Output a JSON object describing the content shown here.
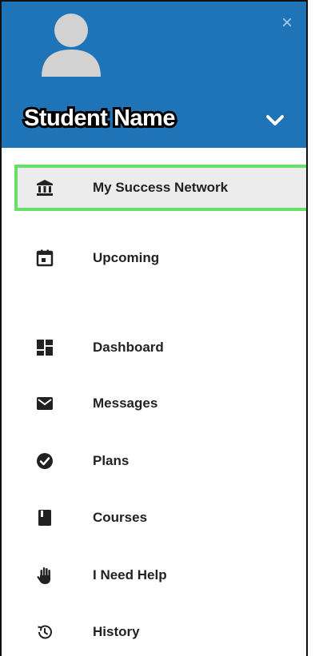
{
  "header": {
    "student_name": "Student Name",
    "close_icon": "×",
    "background_color": "#1f73b7"
  },
  "nav": {
    "items": [
      {
        "label": "My Success Network",
        "icon": "bank-icon",
        "active": true
      },
      {
        "label": "Upcoming",
        "icon": "calendar-icon"
      },
      {
        "label": "Dashboard",
        "icon": "dashboard-icon"
      },
      {
        "label": "Messages",
        "icon": "mail-icon"
      },
      {
        "label": "Plans",
        "icon": "check-circle-icon"
      },
      {
        "label": "Courses",
        "icon": "book-icon"
      },
      {
        "label": "I Need Help",
        "icon": "hand-icon"
      },
      {
        "label": "History",
        "icon": "history-icon"
      }
    ],
    "active_highlight_color": "#66e066"
  }
}
